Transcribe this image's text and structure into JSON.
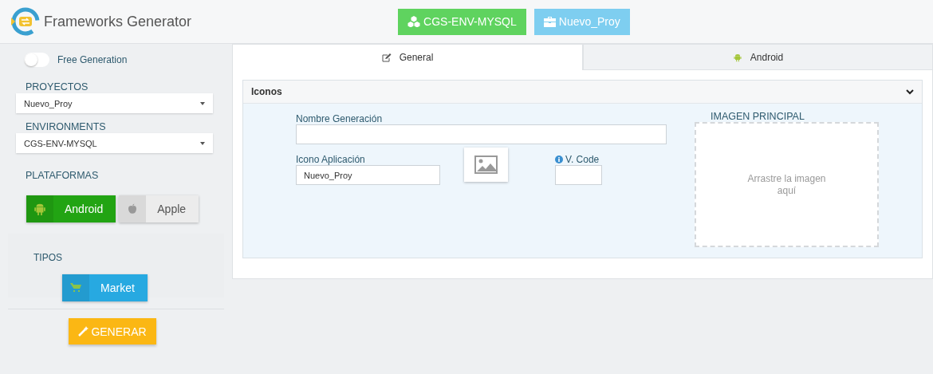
{
  "header": {
    "title": "Frameworks Generator",
    "badges": [
      {
        "label": "CGS-ENV-MYSQL",
        "kind": "environment"
      },
      {
        "label": "Nuevo_Proy",
        "kind": "project"
      }
    ]
  },
  "sidebar": {
    "free_generation": {
      "label": "Free Generation",
      "on": false
    },
    "proyectos": {
      "label": "PROYECTOS",
      "value": "Nuevo_Proy"
    },
    "environments": {
      "label": "ENVIRONMENTS",
      "value": "CGS-ENV-MYSQL"
    },
    "plataformas": {
      "label": "PLATAFORMAS",
      "items": [
        {
          "label": "Android",
          "kind": "android",
          "selected": true
        },
        {
          "label": "Apple",
          "kind": "apple",
          "selected": false
        }
      ]
    },
    "tipos": {
      "label": "TIPOS",
      "items": [
        {
          "label": "Market",
          "kind": "market",
          "selected": true
        }
      ]
    },
    "generate_button": "GENERAR"
  },
  "tabs": [
    {
      "label": "General",
      "kind": "general",
      "selected": true
    },
    {
      "label": "Android",
      "kind": "android",
      "selected": false
    }
  ],
  "panel": {
    "title": "Iconos",
    "expanded": true,
    "nombre_generacion": {
      "label": "Nombre Generación"
    },
    "icono_aplicacion": {
      "label": "Icono Aplicación",
      "value": "Nuevo_Proy"
    },
    "v_code": {
      "label": "V. Code"
    },
    "imagen_principal": {
      "label": "IMAGEN PRINCIPAL",
      "hint": "Arrastre la imagen aquí"
    }
  }
}
